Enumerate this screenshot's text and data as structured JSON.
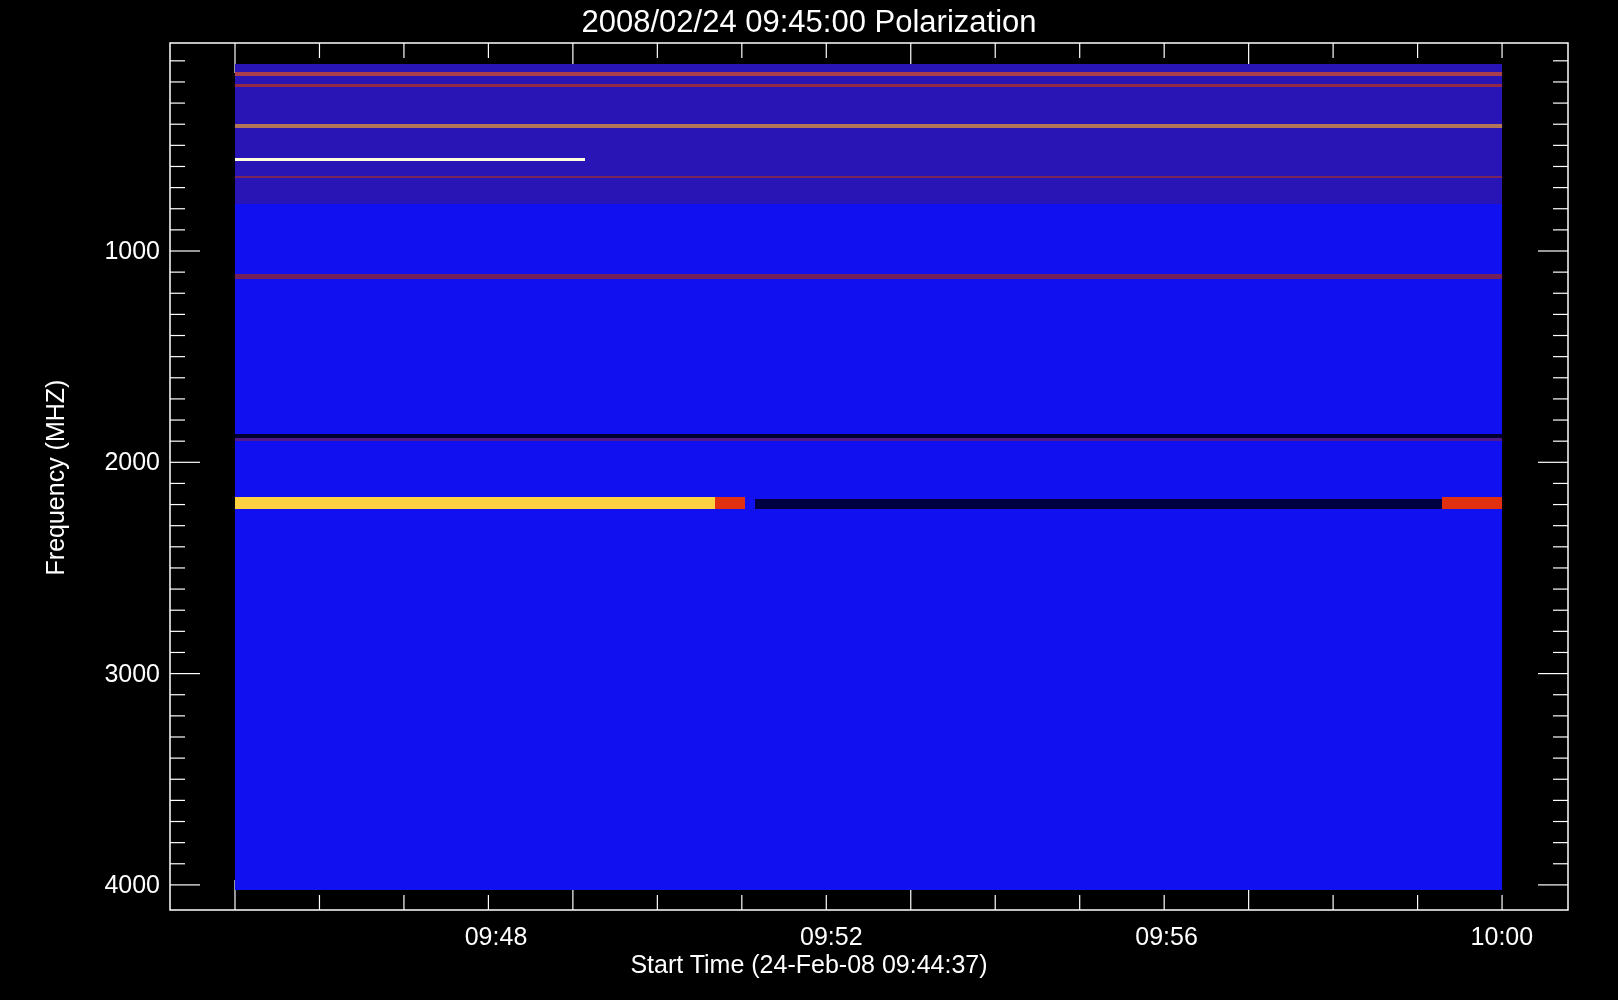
{
  "title": "2008/02/24 09:45:00 Polarization",
  "y_axis": {
    "label": "Frequency (MHZ)",
    "ticks": [
      "1000",
      "2000",
      "3000",
      "4000"
    ]
  },
  "x_axis": {
    "label": "Start Time (24-Feb-08 09:44:37)",
    "ticks": [
      "09:48",
      "09:52",
      "09:56",
      "10:00"
    ]
  }
}
